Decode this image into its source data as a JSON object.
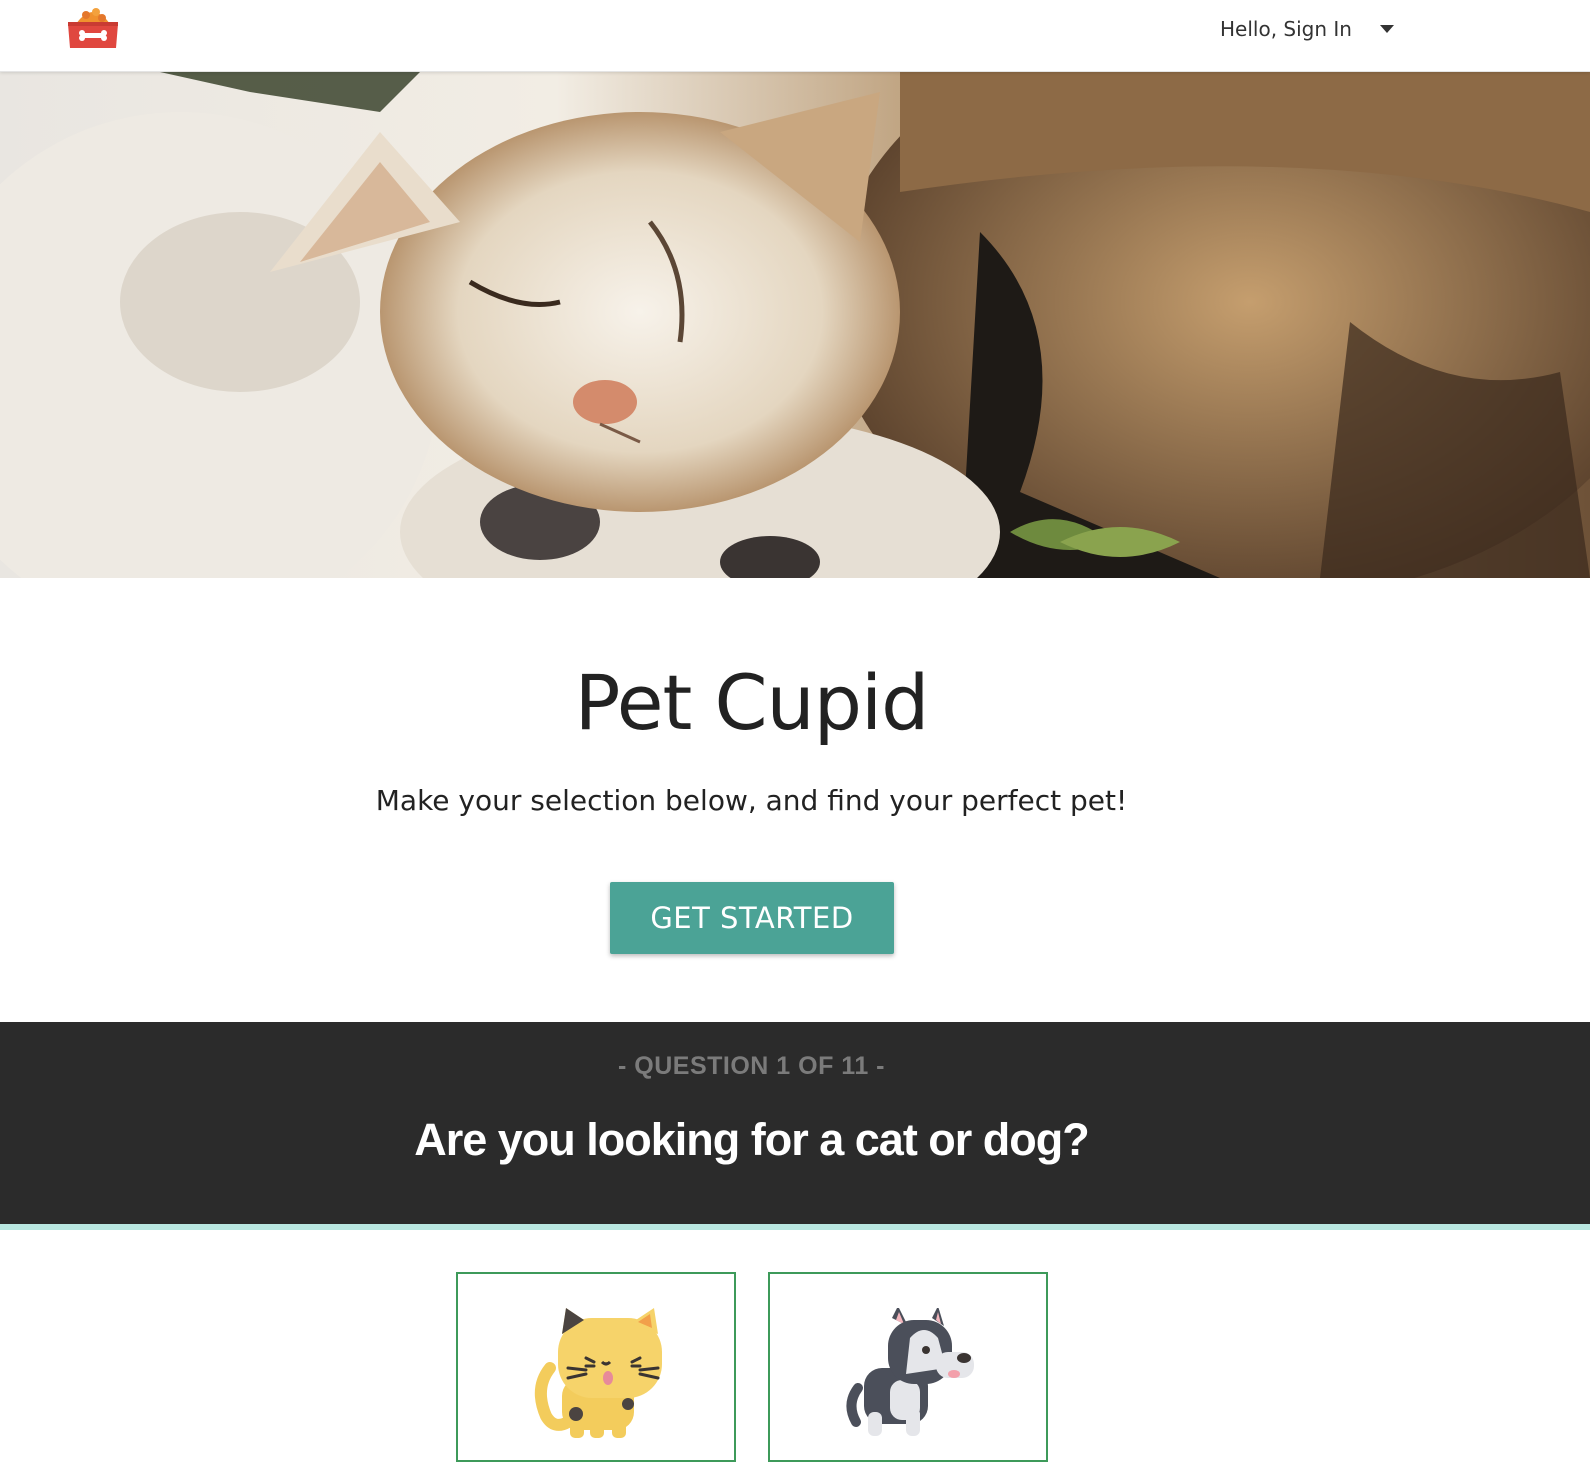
{
  "header": {
    "logo_icon": "pet-food-bowl-icon",
    "user_greeting": "Hello, Sign In",
    "menu_icon": "caret-down-icon"
  },
  "hero": {
    "image": "cat-and-dog-cuddling-photo"
  },
  "intro": {
    "title": "Pet Cupid",
    "subtitle": "Make your selection below, and find your perfect pet!",
    "cta_label": "GET STARTED"
  },
  "question": {
    "counter": "- QUESTION 1 OF 11 -",
    "text": "Are you looking for a cat or dog?"
  },
  "options": [
    {
      "id": "cat",
      "icon": "cat-icon"
    },
    {
      "id": "dog",
      "icon": "dog-icon"
    }
  ],
  "colors": {
    "accent": "#4ba396",
    "band_bg": "#2b2b2b",
    "band_underline": "#b9e7e0",
    "card_border": "#3d9a5a",
    "logo_red": "#e0473f",
    "logo_orange": "#f0912e"
  }
}
